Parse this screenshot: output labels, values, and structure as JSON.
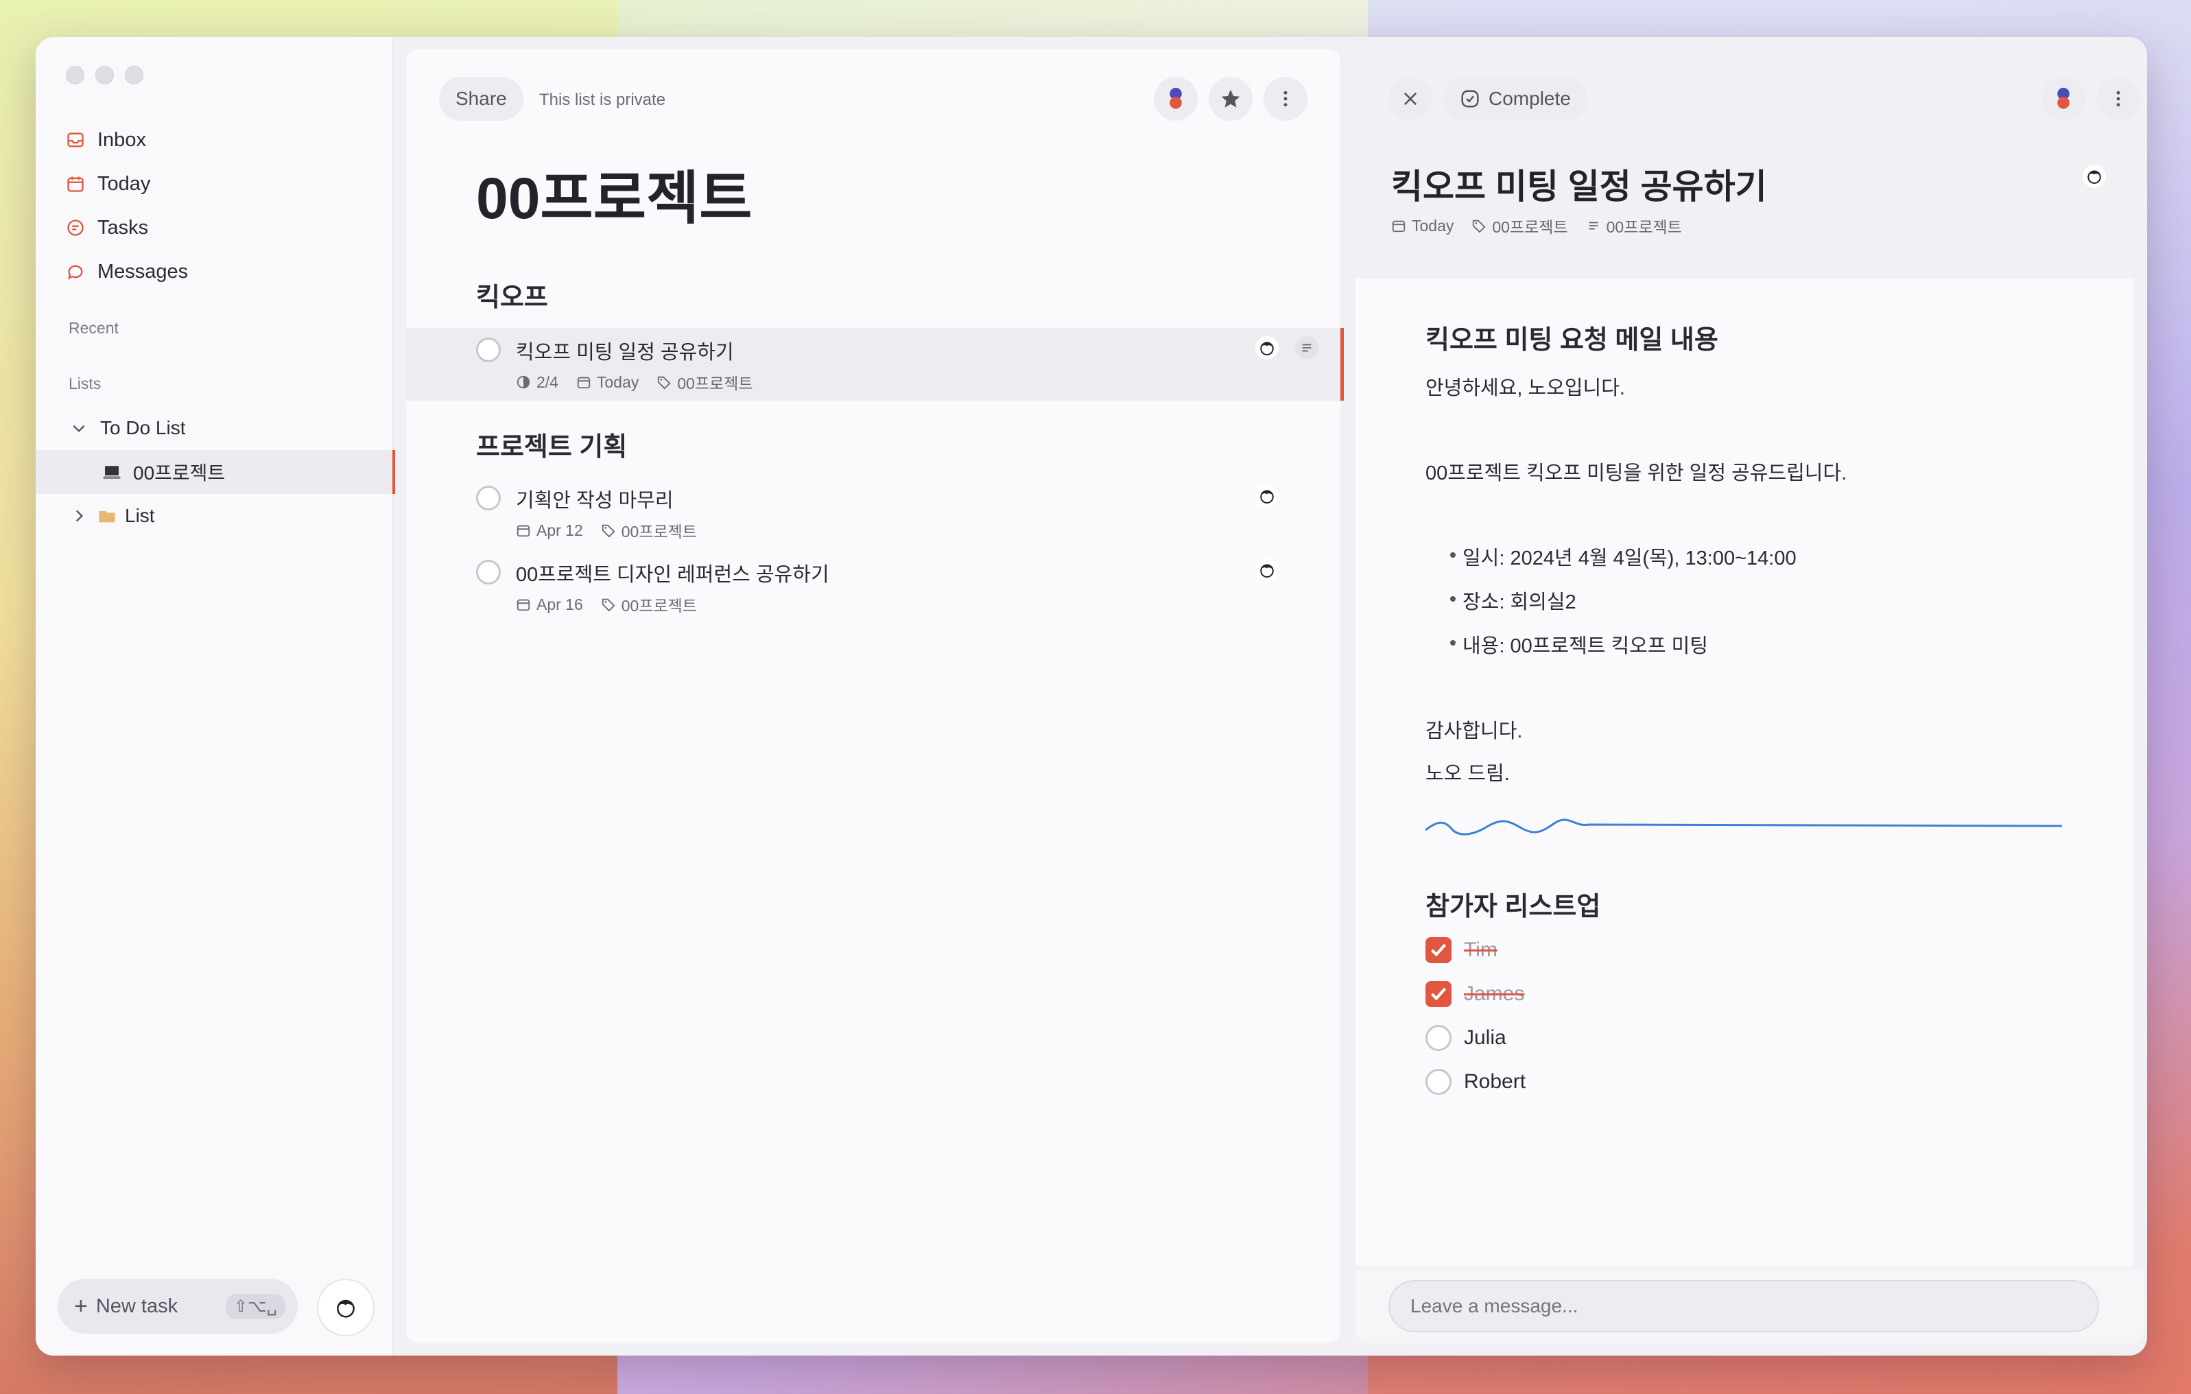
{
  "sidebar": {
    "nav": [
      {
        "label": "Inbox",
        "icon": "inbox-icon"
      },
      {
        "label": "Today",
        "icon": "calendar-icon"
      },
      {
        "label": "Tasks",
        "icon": "tasks-icon"
      },
      {
        "label": "Messages",
        "icon": "messages-icon"
      }
    ],
    "recent_label": "Recent",
    "lists_label": "Lists",
    "tree": {
      "todo": "To Do List",
      "project": "00프로젝트",
      "list": "List"
    },
    "new_task": "New task",
    "shortcut": "⇧⌥␣"
  },
  "list_view": {
    "share": "Share",
    "privacy": "This list is private",
    "title": "00프로젝트",
    "sections": [
      {
        "heading": "킥오프",
        "tasks": [
          {
            "title": "킥오프 미팅 일정 공유하기",
            "progress": "2/4",
            "date": "Today",
            "tag": "00프로젝트"
          }
        ]
      },
      {
        "heading": "프로젝트 기획",
        "tasks": [
          {
            "title": "기획안 작성 마무리",
            "date": "Apr 12",
            "tag": "00프로젝트"
          },
          {
            "title": "00프로젝트 디자인 레퍼런스 공유하기",
            "date": "Apr 16",
            "tag": "00프로젝트"
          }
        ]
      }
    ]
  },
  "detail": {
    "complete": "Complete",
    "title": "킥오프 미팅 일정 공유하기",
    "meta": {
      "date": "Today",
      "tag": "00프로젝트",
      "list": "00프로젝트"
    },
    "heading1": "킥오프 미팅 요청 메일 내용",
    "greeting": "안녕하세요, 노오입니다.",
    "intro": "00프로젝트 킥오프 미팅을 위한 일정 공유드립니다.",
    "bullets": [
      "일시: 2024년 4월 4일(목), 13:00~14:00",
      "장소: 회의실2",
      "내용: 00프로젝트 킥오프 미팅"
    ],
    "thanks": "감사합니다.",
    "sign": "노오 드림.",
    "heading2": "참가자 리스트업",
    "checklist": [
      {
        "label": "Tim",
        "done": true
      },
      {
        "label": "James",
        "done": true
      },
      {
        "label": "Julia",
        "done": false
      },
      {
        "label": "Robert",
        "done": false
      }
    ],
    "message_placeholder": "Leave a message...",
    "colors": {
      "accent": "#e0563f",
      "squiggle": "#3b82d6"
    }
  }
}
